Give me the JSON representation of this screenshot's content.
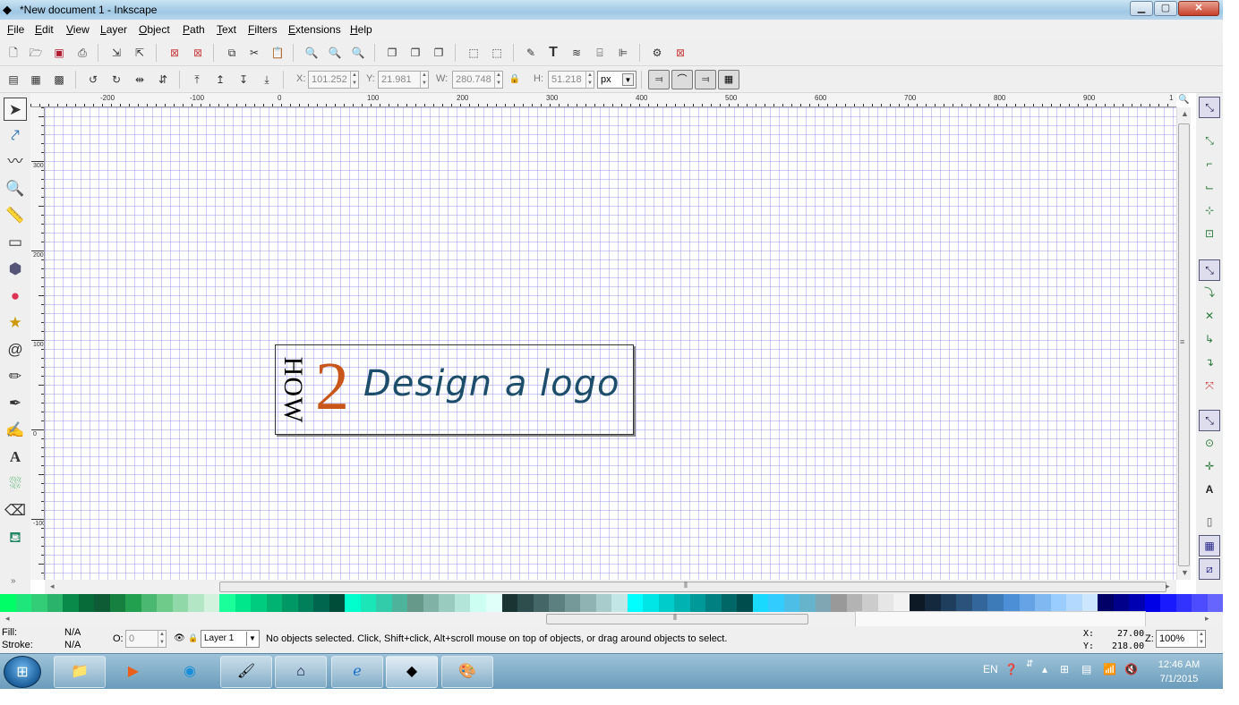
{
  "window": {
    "title": "*New document 1 - Inkscape",
    "minimize": "▁",
    "maximize": "▢",
    "close": "✕"
  },
  "menu": [
    "File",
    "Edit",
    "View",
    "Layer",
    "Object",
    "Path",
    "Text",
    "Filters",
    "Extensions",
    "Help"
  ],
  "command_icons": [
    "new-icon",
    "open-icon",
    "save-icon",
    "print-icon",
    "import-icon",
    "export-icon",
    "undo-icon",
    "redo-icon",
    "copy-icon",
    "cut-icon",
    "paste-icon",
    "zoom-selection-icon",
    "zoom-drawing-icon",
    "zoom-page-icon",
    "duplicate-icon",
    "clone-icon",
    "unlink-clone-icon",
    "group-icon",
    "ungroup-icon",
    "fill-stroke-icon",
    "text-font-icon",
    "layers-icon",
    "xml-editor-icon",
    "align-icon",
    "preferences-icon",
    "document-properties-icon"
  ],
  "selector_controls": {
    "x_label": "X:",
    "x_value": "101.252",
    "y_label": "Y:",
    "y_value": "21.981",
    "w_label": "W:",
    "w_value": "280.748",
    "h_label": "H:",
    "h_value": "51.218",
    "unit": "px"
  },
  "ruler_top_labels": [
    "-200",
    "-100",
    "0",
    "100",
    "200",
    "300",
    "400",
    "500",
    "600",
    "700",
    "800",
    "900",
    "1"
  ],
  "ruler_left_labels": [
    "300",
    "200",
    "100",
    "0",
    "-100"
  ],
  "logo": {
    "how": "HOW",
    "two": "2",
    "text": "Design a logo"
  },
  "status": {
    "fill_label": "Fill:",
    "fill_value": "N/A",
    "stroke_label": "Stroke:",
    "stroke_value": "N/A",
    "opacity_label": "O:",
    "opacity_value": "0",
    "layer": "Layer 1",
    "message": "No objects selected. Click, Shift+click, Alt+scroll mouse on top of objects, or drag around objects to select.",
    "x_label": "X:",
    "x_value": "27.00",
    "y_label": "Y:",
    "y_value": "218.00",
    "zoom_label": "Z:",
    "zoom_value": "100%"
  },
  "taskbar": {
    "lang": "EN",
    "time": "12:46 AM",
    "date": "7/1/2015"
  },
  "palette": [
    "#00ff66",
    "#1ee67a",
    "#33cc77",
    "#2ab36a",
    "#0a8a4a",
    "#066b38",
    "#0d5c35",
    "#15803f",
    "#22a050",
    "#4ab870",
    "#6ecb8a",
    "#90d8a8",
    "#b3e6c4",
    "#d2f2dd",
    "#1aff99",
    "#00e68a",
    "#00cc80",
    "#00b373",
    "#009966",
    "#00805a",
    "#00664d",
    "#004d3a",
    "#00ffcc",
    "#1ae6b8",
    "#33ccaa",
    "#4db39a",
    "#66998a",
    "#80b3a5",
    "#99ccbf",
    "#b3e6d9",
    "#ccfff2",
    "#e0fff8",
    "#1a3333",
    "#2e4d4d",
    "#446666",
    "#5c8080",
    "#759999",
    "#8fb3b3",
    "#a8cccc",
    "#c2e6e6",
    "#00ffff",
    "#00e6e6",
    "#00cccc",
    "#00b3b3",
    "#009999",
    "#008080",
    "#006666",
    "#004d4d",
    "#1ad9ff",
    "#33ccff",
    "#4dbfe6",
    "#66b3cc",
    "#80a6b3",
    "#999999",
    "#b3b3b3",
    "#cccccc",
    "#e6e6e6",
    "#f2f2f2",
    "#0d1a26",
    "#14293d",
    "#1f3d5c",
    "#2a527a",
    "#33669a",
    "#3d7ab8",
    "#4d8fd6",
    "#66a3e6",
    "#80b8f2",
    "#99ccff",
    "#b3d9ff",
    "#cce6ff",
    "#000066",
    "#00008b",
    "#0000b3",
    "#0000e6",
    "#1a1aff",
    "#3333ff",
    "#4d4dff",
    "#6666ff"
  ],
  "colors": {
    "logo_two": "#c8561a",
    "logo_text": "#1c4d6a",
    "grid": "#6e6ee6"
  }
}
